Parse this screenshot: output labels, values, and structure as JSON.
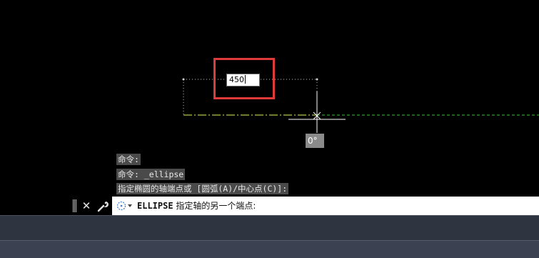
{
  "canvas": {
    "dimension_input_value": "450",
    "angle_tooltip": "0°"
  },
  "command_history": [
    "命令:",
    "命令: _ellipse",
    "指定椭圆的轴端点或 [圆弧(A)/中心点(C)]:"
  ],
  "command_line": {
    "command_name": "ELLIPSE",
    "prompt": "指定轴的另一个端点:",
    "grip_icon": "grip-icon",
    "close_icon": "close-icon",
    "customize_icon": "wrench-icon",
    "recent_commands_icon": "recent-commands-icon"
  },
  "colors": {
    "canvas_background": "#000000",
    "highlight": "#e03a3a",
    "tracking_line": "#3cc43c",
    "crosshair": "#ffffff",
    "status_bar": "#2e3440"
  }
}
